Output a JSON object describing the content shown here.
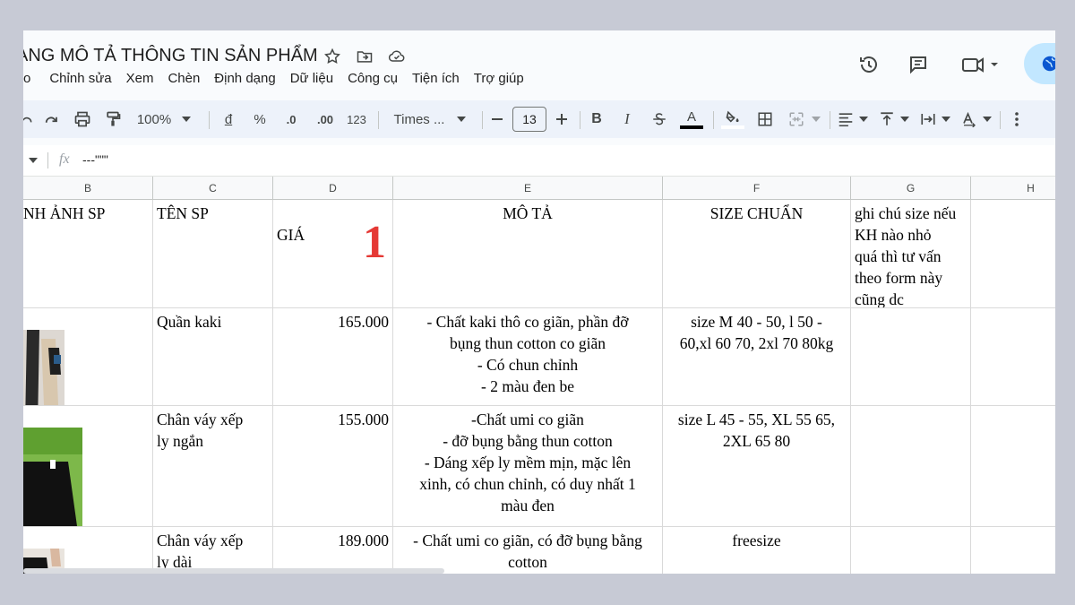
{
  "doc": {
    "title": "ANG MÔ TẢ THÔNG TIN SẢN PHẨM"
  },
  "menu": [
    "o",
    "Chỉnh sửa",
    "Xem",
    "Chèn",
    "Định dạng",
    "Dữ liệu",
    "Công cụ",
    "Tiện ích",
    "Trợ giúp"
  ],
  "toolbar": {
    "zoom": "100%",
    "currency": "đ",
    "percent": "%",
    "decrease_decimal": ".0",
    "increase_decimal": ".00",
    "number_format": "123",
    "font": "Times ...",
    "font_size": "13",
    "bold": "B",
    "italic": "I",
    "text_color_letter": "A",
    "text_color": "#000000"
  },
  "formula_bar": {
    "fx": "fx",
    "value": "---\"\"\""
  },
  "columns": [
    "B",
    "C",
    "D",
    "E",
    "F",
    "G",
    "H"
  ],
  "header_row": {
    "b": "NH ẢNH SP",
    "c": "TÊN SP",
    "d": "GIÁ",
    "e": "MÔ TẢ",
    "f": "SIZE CHUẨN",
    "g": "ghi chú size nếu\nKH nào nhỏ\nquá thì tư vấn\ntheo form này\ncũng dc"
  },
  "annotation": {
    "text": "1",
    "color": "#e53935"
  },
  "rows": [
    {
      "name": "Quần kaki",
      "price": "165.000",
      "desc": "- Chất kaki thô co giãn, phần đỡ\nbụng thun cotton co giãn\n- Có chun chỉnh\n- 2 màu đen be",
      "size": "size M 40 - 50, l 50 -\n60,xl 60 70, 2xl 70 80kg"
    },
    {
      "name": "Chân váy xếp\nly ngắn",
      "price": "155.000",
      "desc": "-Chất umi co giãn\n- đỡ bụng bằng thun cotton\n- Dáng xếp ly mềm mịn, mặc lên\nxinh, có chun chỉnh, có duy nhất 1\nmàu đen",
      "size": "size L 45 - 55, XL 55 65,\n2XL 65 80"
    },
    {
      "name": "Chân váy xếp\nly dài",
      "price": "189.000",
      "desc": "- Chất umi co giãn, có đỡ bụng bằng\ncotton",
      "size": "freesize"
    }
  ]
}
